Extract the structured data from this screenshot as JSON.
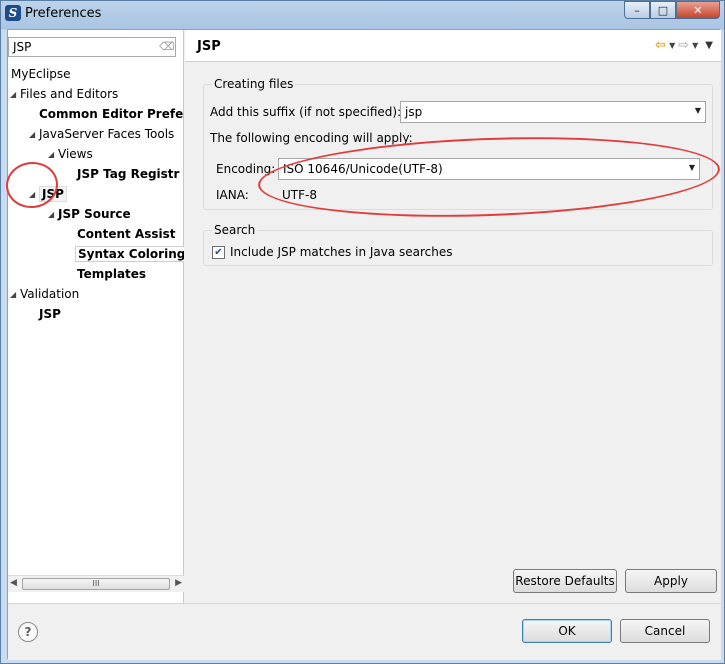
{
  "window": {
    "title": "Preferences"
  },
  "window_controls": {
    "minimize": "–",
    "maximize": "□",
    "close": "✕"
  },
  "filter": {
    "value": "JSP",
    "clear_glyph": "⌫"
  },
  "tree": [
    {
      "label": "MyEclipse",
      "indent": 0,
      "toggle": "",
      "bold": false
    },
    {
      "label": "Files and Editors",
      "indent": 0,
      "toggle": "◢",
      "bold": false
    },
    {
      "label": "Common Editor Prefe",
      "indent": 2,
      "toggle": "",
      "bold": true
    },
    {
      "label": "JavaServer Faces Tools",
      "indent": 1,
      "toggle": "◢",
      "bold": false
    },
    {
      "label": "Views",
      "indent": 2,
      "toggle": "◢",
      "bold": false
    },
    {
      "label": "JSP Tag Registr",
      "indent": 3,
      "toggle": "",
      "bold": true
    },
    {
      "label": "JSP",
      "indent": 1,
      "toggle": "◢",
      "bold": true,
      "selected": true
    },
    {
      "label": "JSP Source",
      "indent": 2,
      "toggle": "◢",
      "bold": true
    },
    {
      "label": "Content Assist",
      "indent": 3,
      "toggle": "",
      "bold": true
    },
    {
      "label": "Syntax Coloring",
      "indent": 3,
      "toggle": "",
      "bold": true,
      "hover": true
    },
    {
      "label": "Templates",
      "indent": 3,
      "toggle": "",
      "bold": true
    },
    {
      "label": "Validation",
      "indent": 0,
      "toggle": "◢",
      "bold": false
    },
    {
      "label": "JSP",
      "indent": 1,
      "toggle": "",
      "bold": true
    }
  ],
  "hscroll": {
    "grip": "III"
  },
  "page": {
    "title": "JSP",
    "nav": {
      "back": "⇦",
      "forward": "⇨",
      "dropdown": "▼",
      "menu": "▼"
    }
  },
  "creating_files": {
    "label": "Creating files",
    "suffix_label": "Add this suffix (if not specified):",
    "suffix_value": "jsp",
    "encoding_note": "The following encoding will apply:",
    "encoding_label": "Encoding:",
    "encoding_value": "ISO 10646/Unicode(UTF-8)",
    "iana_label": "IANA:",
    "iana_value": "UTF-8"
  },
  "search": {
    "label": "Search",
    "include_label": "Include JSP matches in Java searches",
    "checked": true,
    "check_glyph": "✔"
  },
  "buttons": {
    "restore_defaults": "Restore Defaults",
    "apply": "Apply",
    "ok": "OK",
    "cancel": "Cancel",
    "help": "?"
  },
  "colors": {
    "annotation": "#e33b3b",
    "back_arrow": "#e1a21d",
    "checkmark": "#1c4f9c"
  }
}
